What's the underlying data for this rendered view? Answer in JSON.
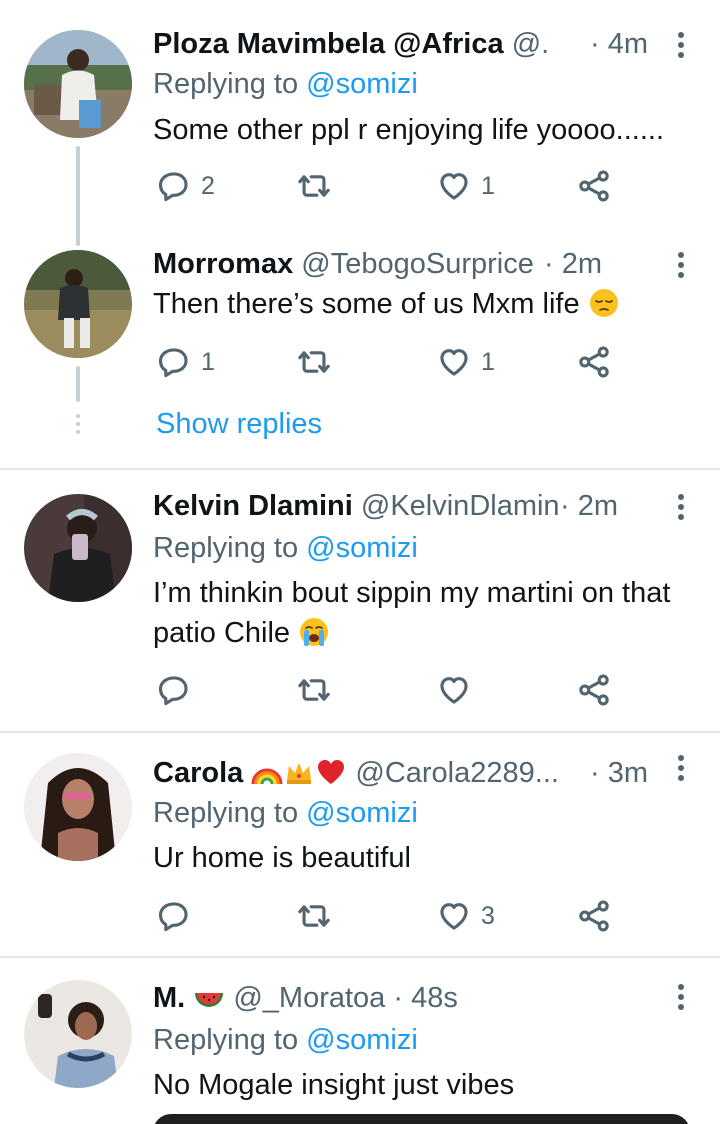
{
  "tweets": [
    {
      "name": "Ploza Mavimbela @Africa",
      "handle": "@...",
      "time": "· 4m",
      "replying_label": "Replying to",
      "replying_mention": "@somizi",
      "text": "Some other ppl r enjoying life yoooo......",
      "replies": "2",
      "retweets": "",
      "likes": "1"
    },
    {
      "name": "Morromax",
      "handle": "@TebogoSurprice",
      "time": "· 2m",
      "text": "Then there’s some of us Mxm life",
      "text_emoji": "pensive-face-emoji",
      "replies": "1",
      "retweets": "",
      "likes": "1",
      "show_replies": "Show replies"
    },
    {
      "name": "Kelvin Dlamini",
      "handle": "@KelvinDlamin",
      "time": "· 2m",
      "replying_label": "Replying to",
      "replying_mention": "@somizi",
      "text_line1": "I’m thinkin bout sippin my martini on that",
      "text_line2": "patio Chile",
      "text_emoji": "loudly-crying-face-emoji",
      "replies": "",
      "retweets": "",
      "likes": ""
    },
    {
      "name": "Carola",
      "name_emojis": [
        "rainbow-emoji",
        "crown-emoji",
        "red-heart-emoji"
      ],
      "handle": "@Carola2289...",
      "time": "· 3m",
      "replying_label": "Replying to",
      "replying_mention": "@somizi",
      "text": "Ur home is beautiful",
      "replies": "",
      "retweets": "",
      "likes": "3"
    },
    {
      "name": "M.",
      "name_emojis": [
        "watermelon-emoji"
      ],
      "handle": "@_Moratoa",
      "time": "· 48s",
      "replying_label": "Replying to",
      "replying_mention": "@somizi",
      "text": "No Mogale insight just vibes"
    }
  ],
  "colors": {
    "text": "#0f1419",
    "secondary": "#536471",
    "accent": "#1d9bf0",
    "divider": "#e5e9ec",
    "thread_line": "#c4cfd6"
  },
  "icons": {
    "reply": "reply-icon",
    "retweet": "retweet-icon",
    "like": "heart-icon",
    "share": "share-icon",
    "more": "more-vertical-icon"
  }
}
